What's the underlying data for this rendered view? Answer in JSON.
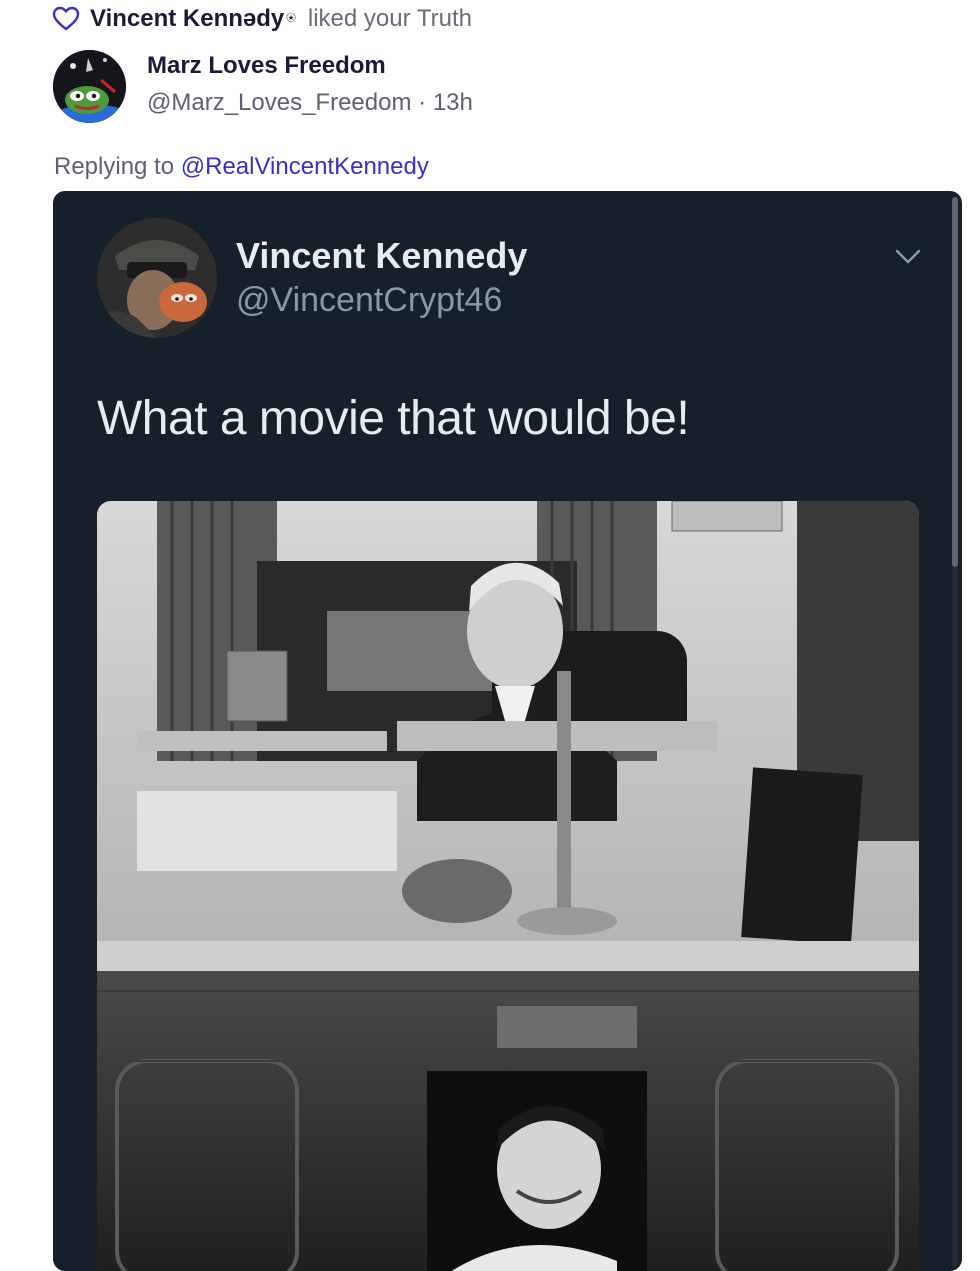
{
  "notification": {
    "icon": "heart-outline-icon",
    "liker_name": "Vincent Kennədy",
    "liker_badge": "⍟",
    "action_text": "liked your Truth"
  },
  "post": {
    "author_name": "Marz Loves Freedom",
    "author_handle": "@Marz_Loves_Freedom",
    "separator": "·",
    "time_ago": "13h",
    "avatar_icon": "frog-avatar",
    "replying_prefix": "Replying to",
    "replying_handle": "@RealVincentKennedy"
  },
  "embedded_tweet": {
    "name": "Vincent Kennedy",
    "handle": "@VincentCrypt46",
    "text": "What a movie that would be!",
    "menu_icon": "chevron-down-icon",
    "image_alt": "black-and-white Oval Office desk photo"
  },
  "colors": {
    "accent": "#3b2fc9",
    "dark_text": "#1b1b38",
    "muted_text": "#5f6070",
    "embed_bg": "#15202b"
  }
}
